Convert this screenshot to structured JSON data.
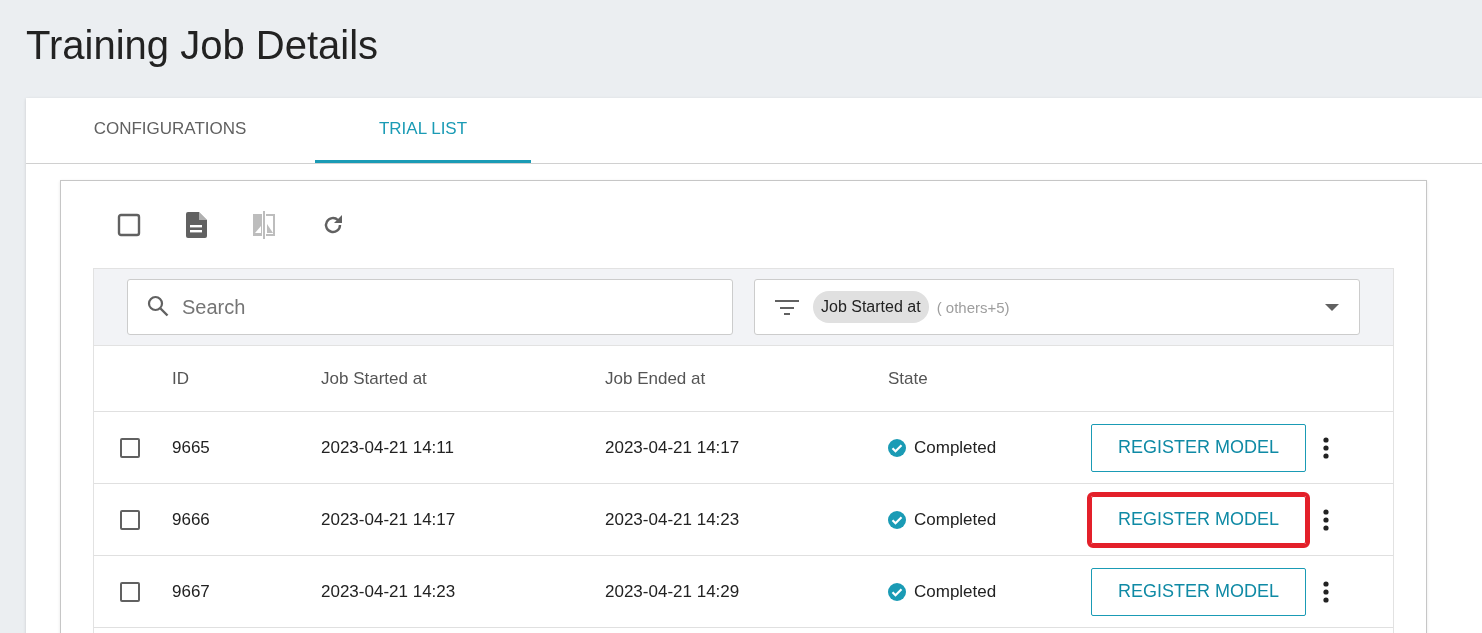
{
  "page_title": "Training Job Details",
  "tabs": [
    {
      "label": "CONFIGURATIONS",
      "selected": false
    },
    {
      "label": "TRIAL LIST",
      "selected": true
    }
  ],
  "toolbar": [
    {
      "kind": "checkbox",
      "checked": false
    },
    {
      "kind": "document",
      "disabled": false
    },
    {
      "kind": "compare",
      "disabled": true
    },
    {
      "kind": "refresh",
      "disabled": false
    }
  ],
  "search": {
    "placeholder": "Search"
  },
  "column_filter": {
    "chip": "Job Started at",
    "more": "( others+5)"
  },
  "table": {
    "columns": [
      "ID",
      "Job Started at",
      "Job Ended at",
      "State"
    ],
    "rows": [
      {
        "checked": false,
        "id": "9665",
        "started": "2023-04-21 14:11",
        "ended": "2023-04-21 14:17",
        "state": "Completed",
        "action": "REGISTER MODEL",
        "highlighted": false
      },
      {
        "checked": false,
        "id": "9666",
        "started": "2023-04-21 14:17",
        "ended": "2023-04-21 14:23",
        "state": "Completed",
        "action": "REGISTER MODEL",
        "highlighted": true
      },
      {
        "checked": false,
        "id": "9667",
        "started": "2023-04-21 14:23",
        "ended": "2023-04-21 14:29",
        "state": "Completed",
        "action": "REGISTER MODEL",
        "highlighted": false
      }
    ]
  }
}
